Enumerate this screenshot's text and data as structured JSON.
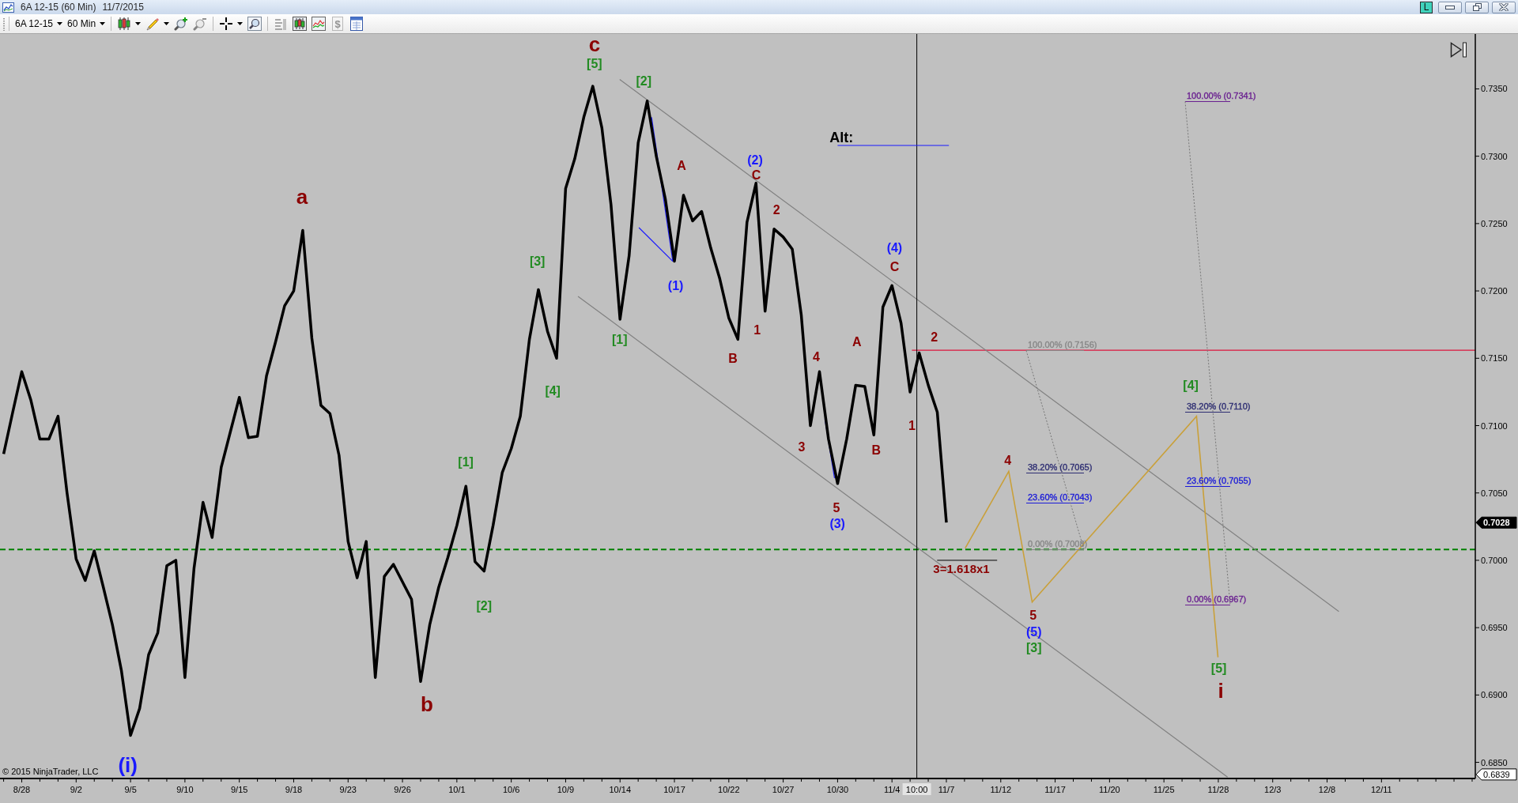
{
  "window": {
    "title": "6A 12-15 (60 Min)",
    "date": "11/7/2015",
    "badge": "L"
  },
  "toolbar": {
    "instrument": "6A 12-15",
    "interval": "60 Min",
    "tools": [
      {
        "kind": "candles",
        "dropdown": true,
        "disabled": false,
        "separator_before": true
      },
      {
        "kind": "pencil",
        "dropdown": true,
        "disabled": false,
        "separator_before": false
      },
      {
        "kind": "zoomin",
        "dropdown": false,
        "disabled": false,
        "separator_before": false
      },
      {
        "kind": "zoomout",
        "dropdown": false,
        "disabled": true,
        "separator_before": false
      },
      {
        "kind": "crosshair",
        "dropdown": true,
        "disabled": false,
        "separator_before": true
      },
      {
        "kind": "magnifier",
        "dropdown": false,
        "disabled": false,
        "separator_before": false
      },
      {
        "kind": "strategy",
        "dropdown": false,
        "disabled": true,
        "separator_before": true
      },
      {
        "kind": "barchart",
        "dropdown": false,
        "disabled": false,
        "separator_before": false
      },
      {
        "kind": "linechart",
        "dropdown": false,
        "disabled": false,
        "separator_before": false
      },
      {
        "kind": "dollar",
        "glyph": "$",
        "dropdown": false,
        "disabled": true,
        "separator_before": false
      },
      {
        "kind": "properties",
        "dropdown": false,
        "disabled": false,
        "separator_before": false
      }
    ]
  },
  "chart": {
    "copyright": "© 2015 NinjaTrader, LLC",
    "last_price": "0.7028",
    "bottom_price": "0.6839",
    "time_marker": "10:00",
    "chart_data": {
      "type": "line",
      "ylim": [
        0.6838,
        0.7389
      ],
      "categories": [
        null,
        null,
        "8/28",
        null,
        null,
        null,
        null,
        null,
        "9/2",
        null,
        null,
        null,
        null,
        null,
        "9/5",
        null,
        null,
        null,
        null,
        null,
        "9/10",
        null,
        null,
        null,
        null,
        null,
        "9/15",
        null,
        null,
        null,
        null,
        null,
        "9/18",
        null,
        null,
        null,
        null,
        null,
        "9/23",
        null,
        null,
        null,
        null,
        null,
        "9/26",
        null,
        null,
        null,
        null,
        null,
        "10/1",
        null,
        null,
        null,
        null,
        null,
        "10/6",
        null,
        null,
        null,
        null,
        null,
        "10/9",
        null,
        null,
        null,
        null,
        null,
        "10/14",
        null,
        null,
        null,
        null,
        null,
        "10/17",
        null,
        null,
        null,
        null,
        null,
        "10/22",
        null,
        null,
        null,
        null,
        null,
        "10/27",
        null,
        null,
        null,
        null,
        null,
        "10/30",
        null,
        null,
        null,
        null,
        null,
        "11/4",
        null,
        null,
        null,
        null,
        null,
        "11/7",
        null,
        null,
        null,
        null,
        null,
        "11/12",
        null,
        null,
        null,
        null,
        null,
        "11/17",
        null,
        null,
        null,
        null,
        null,
        "11/20",
        null,
        null,
        null,
        null,
        null,
        "11/25",
        null,
        null,
        null,
        null,
        null,
        "11/28",
        null,
        null,
        null,
        null,
        null,
        "12/3",
        null,
        null,
        null,
        null,
        null,
        "12/8",
        null,
        null,
        null,
        null,
        null,
        "12/11",
        null,
        null,
        null,
        null,
        null,
        null,
        null,
        null,
        null,
        null
      ],
      "yticks": [
        {
          "value": 0.735,
          "label": "0.7350"
        },
        {
          "value": 0.73,
          "label": "0.7300"
        },
        {
          "value": 0.725,
          "label": "0.7250"
        },
        {
          "value": 0.72,
          "label": "0.7200"
        },
        {
          "value": 0.715,
          "label": "0.7150"
        },
        {
          "value": 0.71,
          "label": "0.7100"
        },
        {
          "value": 0.705,
          "label": "0.7050"
        },
        {
          "value": 0.7,
          "label": "0.7000"
        },
        {
          "value": 0.695,
          "label": "0.6950"
        },
        {
          "value": 0.69,
          "label": "0.6900"
        },
        {
          "value": 0.685,
          "label": "0.6850"
        }
      ],
      "values": [
        0.7079,
        0.711,
        0.714,
        0.7119,
        0.709,
        0.709,
        0.7107,
        0.705,
        0.7001,
        0.6985,
        0.7007,
        0.698,
        0.6952,
        0.6918,
        0.687,
        0.689,
        0.693,
        0.6946,
        0.6996,
        0.7,
        0.6913,
        0.6994,
        0.7043,
        0.7017,
        0.7069,
        0.7095,
        0.7121,
        0.7091,
        0.7092,
        0.7137,
        0.7162,
        0.7189,
        0.72,
        0.7245,
        0.7165,
        0.7115,
        0.7109,
        0.7078,
        0.7014,
        0.6987,
        0.7014,
        0.6913,
        0.6988,
        0.6997,
        0.6984,
        0.6971,
        0.691,
        0.6952,
        0.698,
        0.7002,
        0.7026,
        0.7055,
        0.6999,
        0.6992,
        0.7026,
        0.7065,
        0.7083,
        0.7107,
        0.7164,
        0.7201,
        0.717,
        0.715,
        0.7276,
        0.7298,
        0.7329,
        0.7352,
        0.7321,
        0.7264,
        0.7179,
        0.7226,
        0.731,
        0.7341,
        0.73,
        0.7268,
        0.7222,
        0.7271,
        0.7252,
        0.7259,
        0.7232,
        0.7209,
        0.718,
        0.7164,
        0.7251,
        0.728,
        0.7185,
        0.7246,
        0.724,
        0.7231,
        0.7182,
        0.71,
        0.714,
        0.709,
        0.7057,
        0.709,
        0.713,
        0.7129,
        0.7093,
        0.7188,
        0.7204,
        0.7176,
        0.7125,
        0.7154,
        0.713,
        0.711,
        0.7028,
        null,
        null,
        null,
        null,
        null,
        null,
        null,
        null,
        null,
        null,
        null,
        null,
        null,
        null,
        null,
        null,
        null,
        null,
        null,
        null,
        null,
        null,
        null,
        null,
        null,
        null,
        null,
        null,
        null,
        null,
        null,
        null,
        null,
        null,
        null,
        null,
        null,
        null,
        null,
        null,
        null,
        null,
        null,
        null,
        null,
        null,
        null,
        null,
        null,
        null,
        null,
        null,
        null,
        null,
        null,
        null,
        null,
        null
      ]
    },
    "wave_labels": [
      {
        "text": "c",
        "color": "#8b0000"
      },
      {
        "text": "[5]",
        "color": "#228b22"
      },
      {
        "text": "[2]",
        "color": "#228b22"
      },
      {
        "text": "a",
        "color": "#8b0000"
      },
      {
        "text": "b",
        "color": "#8b0000"
      },
      {
        "text": "(i)",
        "color": "#1a1aff"
      },
      {
        "text": "[1]",
        "color": "#228b22"
      },
      {
        "text": "[2]",
        "color": "#228b22"
      },
      {
        "text": "[3]",
        "color": "#228b22"
      },
      {
        "text": "[4]",
        "color": "#228b22"
      },
      {
        "text": "[1]",
        "color": "#228b22"
      },
      {
        "text": "A",
        "color": "#8b0000"
      },
      {
        "text": "(1)",
        "color": "#1a1aff"
      },
      {
        "text": "(2)",
        "color": "#1a1aff"
      },
      {
        "text": "C",
        "color": "#8b0000"
      },
      {
        "text": "2",
        "color": "#8b0000"
      },
      {
        "text": "B",
        "color": "#8b0000"
      },
      {
        "text": "1",
        "color": "#8b0000"
      },
      {
        "text": "4",
        "color": "#8b0000"
      },
      {
        "text": "3",
        "color": "#8b0000"
      },
      {
        "text": "5",
        "color": "#8b0000"
      },
      {
        "text": "(3)",
        "color": "#1a1aff"
      },
      {
        "text": "A",
        "color": "#8b0000"
      },
      {
        "text": "B",
        "color": "#8b0000"
      },
      {
        "text": "(4)",
        "color": "#1a1aff"
      },
      {
        "text": "C",
        "color": "#8b0000"
      },
      {
        "text": "2",
        "color": "#8b0000"
      },
      {
        "text": "1",
        "color": "#8b0000"
      },
      {
        "text": "4",
        "color": "#8b0000"
      },
      {
        "text": "5",
        "color": "#8b0000"
      },
      {
        "text": "(5)",
        "color": "#1a1aff"
      },
      {
        "text": "[3]",
        "color": "#228b22"
      },
      {
        "text": "[4]",
        "color": "#228b22"
      },
      {
        "text": "[5]",
        "color": "#228b22"
      },
      {
        "text": "i",
        "color": "#8b0000"
      }
    ],
    "notes": [
      {
        "text": "Alt:",
        "color": "#000000"
      },
      {
        "text": "3=1.618x1",
        "color": "#8b0000"
      }
    ],
    "fib_tools": [
      {
        "levels": [
          {
            "label": "100.00% (0.7156)",
            "color": "#878787"
          },
          {
            "label": "38.20% (0.7065)",
            "color": "#2d2d72"
          },
          {
            "label": "23.60% (0.7043)",
            "color": "#1a1ad8"
          },
          {
            "label": "0.00% (0.7008)",
            "color": "#878787"
          }
        ]
      },
      {
        "levels": [
          {
            "label": "100.00% (0.7341)",
            "color": "#6a2090"
          },
          {
            "label": "38.20% (0.7110)",
            "color": "#2d2d72"
          },
          {
            "label": "23.60% (0.7055)",
            "color": "#1a1ad8"
          },
          {
            "label": "0.00% (0.6967)",
            "color": "#6a2090"
          }
        ]
      }
    ]
  }
}
